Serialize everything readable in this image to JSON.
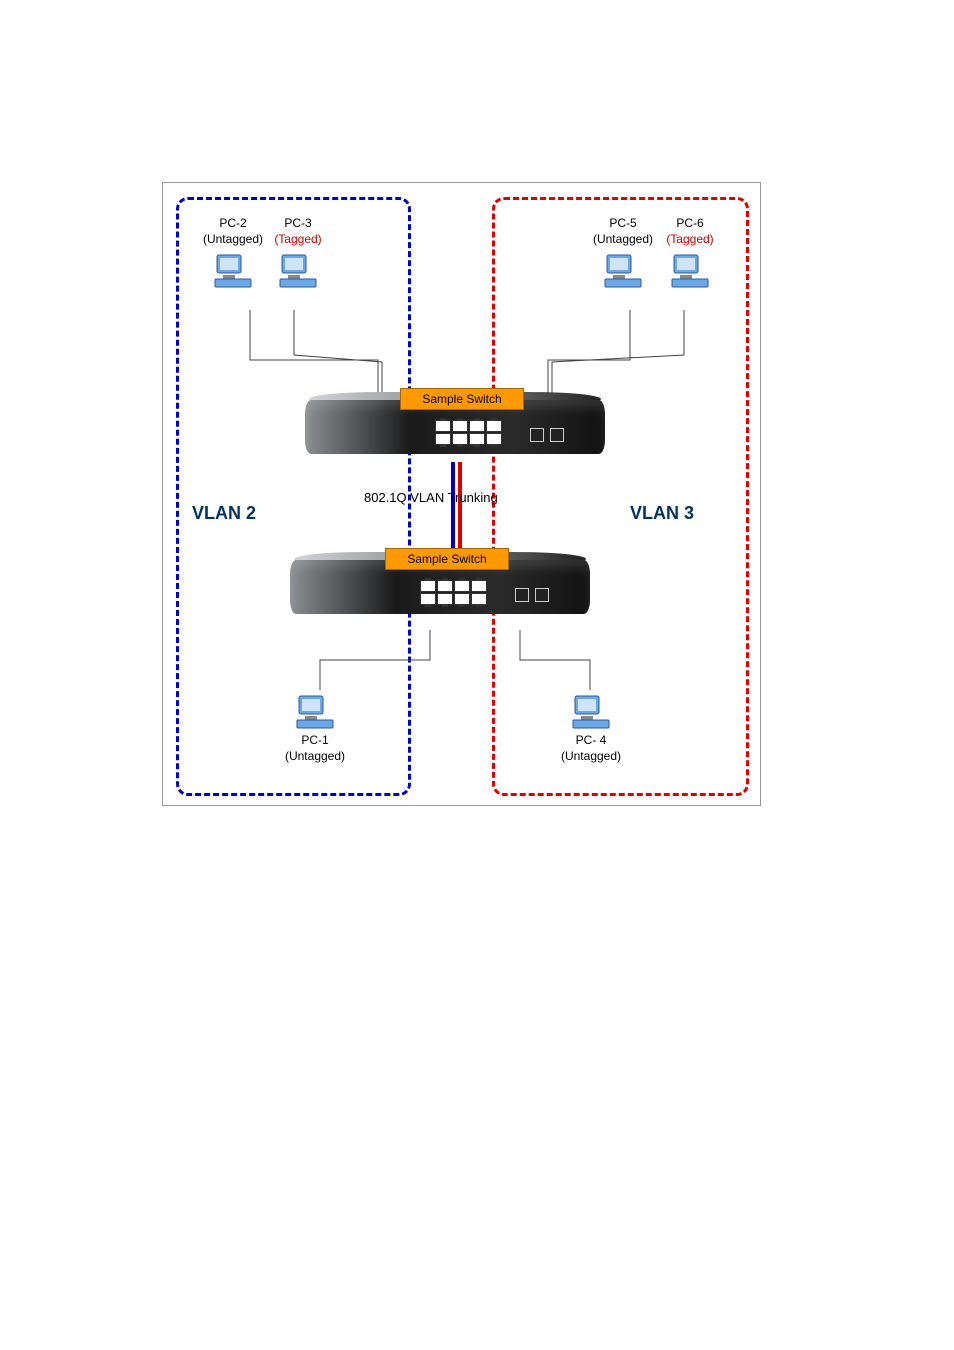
{
  "vlan2_label": "VLAN 2",
  "vlan3_label": "VLAN 3",
  "trunk_label": "802.1Q VLAN Trunking",
  "switches": {
    "top": {
      "label": "Sample Switch"
    },
    "bottom": {
      "label": "Sample Switch"
    }
  },
  "pcs": {
    "pc1": {
      "name": "PC-1",
      "tag": "(Untagged)",
      "tag_style": "untagged"
    },
    "pc2": {
      "name": "PC-2",
      "tag": "(Untagged)",
      "tag_style": "untagged"
    },
    "pc3": {
      "name": "PC-3",
      "tag": "(Tagged)",
      "tag_style": "tagged"
    },
    "pc4": {
      "name": "PC- 4",
      "tag": "(Untagged)",
      "tag_style": "untagged"
    },
    "pc5": {
      "name": "PC-5",
      "tag": "(Untagged)",
      "tag_style": "untagged"
    },
    "pc6": {
      "name": "PC-6",
      "tag": "(Tagged)",
      "tag_style": "tagged"
    }
  }
}
